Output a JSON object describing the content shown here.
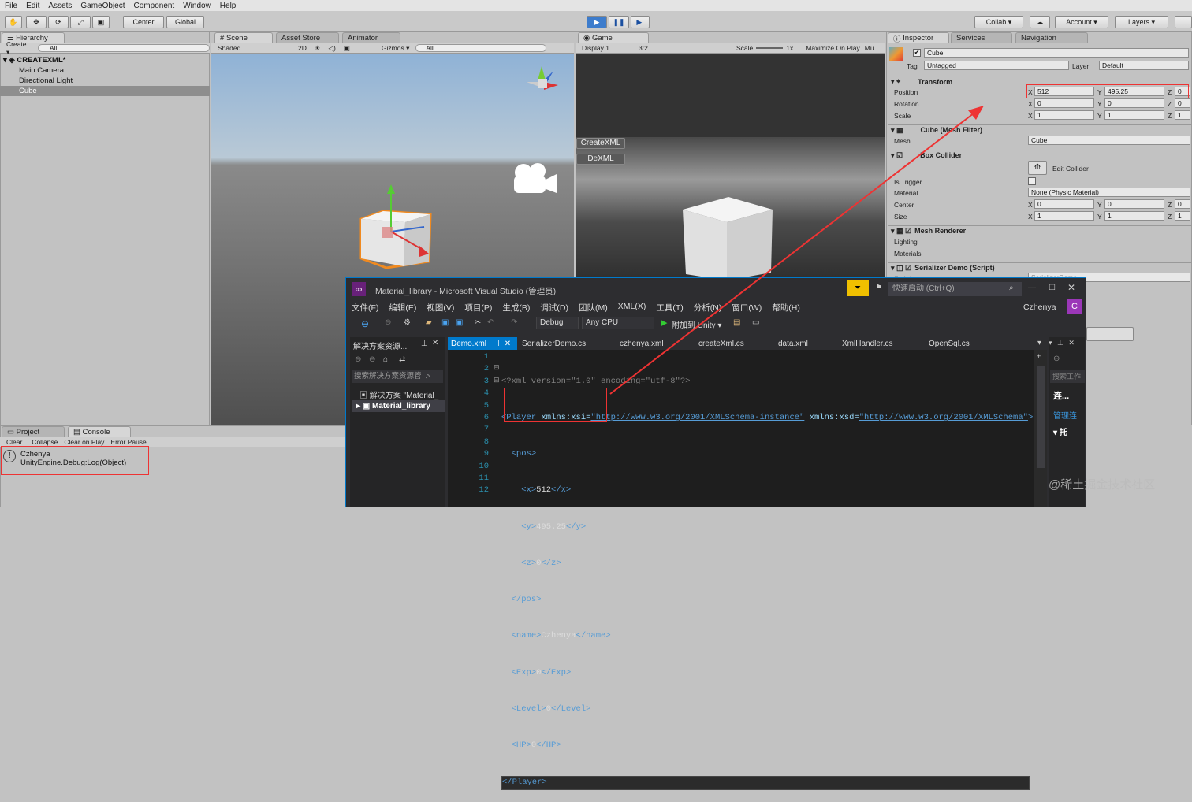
{
  "menu": [
    "File",
    "Edit",
    "Assets",
    "GameObject",
    "Component",
    "Window",
    "Help"
  ],
  "toolbar": {
    "center": "Center",
    "global": "Global",
    "collab": "Collab ▾",
    "account": "Account",
    "layers": "Layers"
  },
  "hierarchy": {
    "tab": "Hierarchy",
    "create": "Create ▾",
    "search": "All",
    "scene": "CREATEXML*",
    "items": [
      "Main Camera",
      "Directional Light",
      "Cube"
    ]
  },
  "scene": {
    "tab": "Scene",
    "asset_store": "Asset Store",
    "animator": "Animator",
    "shaded": "Shaded",
    "mode_2d": "2D",
    "gizmos": "Gizmos ▾",
    "search": "All"
  },
  "game": {
    "tab": "Game",
    "display": "Display 1",
    "aspect": "3:2",
    "scale_label": "Scale",
    "scale_value": "1x",
    "maximize": "Maximize On Play",
    "mu": "Mu",
    "btn_create": "CreateXML",
    "btn_de": "DeXML"
  },
  "inspector": {
    "tab": "Inspector",
    "services": "Services",
    "navigation": "Navigation",
    "name": "Cube",
    "tag_label": "Tag",
    "tag": "Untagged",
    "layer_label": "Layer",
    "layer": "Default",
    "transform": "Transform",
    "position_label": "Position",
    "pos_x": "512",
    "pos_y": "495.25",
    "pos_z": "0",
    "rotation_label": "Rotation",
    "rot_x": "0",
    "rot_y": "0",
    "rot_z": "0",
    "scale_label": "Scale",
    "scale_x": "1",
    "scale_y": "1",
    "scale_z": "1",
    "mesh_filter": "Cube (Mesh Filter)",
    "mesh_label": "Mesh",
    "mesh": "Cube",
    "box_collider": "Box Collider",
    "edit_collider": "Edit Collider",
    "is_trigger": "Is Trigger",
    "material_label": "Material",
    "material": "None (Physic Material)",
    "center_label": "Center",
    "c_x": "0",
    "c_y": "0",
    "c_z": "0",
    "size_label": "Size",
    "s_x": "1",
    "s_y": "1",
    "s_z": "1",
    "mesh_renderer": "Mesh Renderer",
    "lighting": "Lighting",
    "materials": "Materials",
    "script_comp": "Serializer Demo (Script)",
    "script_label": "Script",
    "script": "SerializerDemo",
    "x": "X",
    "y": "Y",
    "z": "Z"
  },
  "bottom": {
    "project": "Project",
    "console": "Console",
    "clear": "Clear",
    "collapse": "Collapse",
    "clear_on_play": "Clear on Play",
    "error_pause": "Error Pause",
    "log1": "Czhenya",
    "log2": "UnityEngine.Debug:Log(Object)"
  },
  "vs": {
    "title": "Material_library - Microsoft Visual Studio (管理员)",
    "quick_launch": "快速启动 (Ctrl+Q)",
    "user": "Czhenya",
    "menu": [
      "文件(F)",
      "编辑(E)",
      "视图(V)",
      "项目(P)",
      "生成(B)",
      "调试(D)",
      "团队(M)",
      "XML(X)",
      "工具(T)",
      "分析(N)",
      "窗口(W)",
      "帮助(H)"
    ],
    "config": "Debug",
    "platform": "Any CPU",
    "attach": "附加到 Unity ▾",
    "solution_title": "解决方案资源...",
    "solution_search": "搜索解决方案资源管",
    "solution_node": "解决方案 \"Material_",
    "project_node": "Material_library",
    "tabs": [
      "Demo.xml",
      "SerializerDemo.cs",
      "czhenya.xml",
      "createXml.cs",
      "data.xml",
      "XmlHandler.cs",
      "OpenSql.cs"
    ],
    "right_search": "搜索工作",
    "right_item1": "连...",
    "right_item2": "管理连",
    "right_item3": "托"
  },
  "code_lines": [
    "1",
    "2",
    "3",
    "4",
    "5",
    "6",
    "7",
    "8",
    "9",
    "10",
    "11",
    "12"
  ],
  "xml": {
    "decl": "<?xml version=\"1.0\" encoding=\"utf-8\"?>",
    "player_open": "<Player",
    "xsi_attr": " xmlns:xsi=",
    "xsi_val": "\"http://www.w3.org/2001/XMLSchema-instance\"",
    "xsd_attr": " xmlns:xsd=",
    "xsd_val": "\"http://www.w3.org/2001/XMLSchema\"",
    "gt": ">",
    "pos_open": "<pos>",
    "x_val": "512",
    "y_val": "495.25",
    "z_val": "0",
    "pos_close": "</pos>",
    "name_val": "Czhenya",
    "exp_val": "0",
    "level_val": "0",
    "hp_val": "0",
    "player_close": "</Player>"
  },
  "watermark": "@稀土掘金技术社区"
}
